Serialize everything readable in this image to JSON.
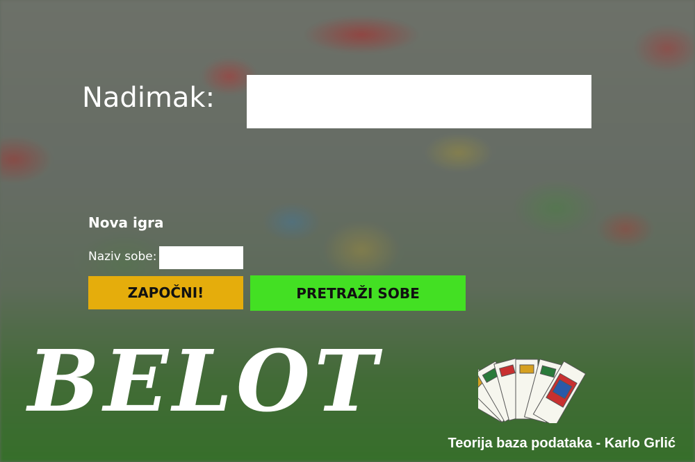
{
  "form": {
    "nickname_label": "Nadimak:",
    "nickname_value": "",
    "new_game_title": "Nova igra",
    "room_name_label": "Naziv sobe:",
    "room_name_value": "",
    "start_button": "ZAPOČNI!",
    "search_rooms_button": "PRETRAŽI SOBE"
  },
  "branding": {
    "logo_text": "BELOT",
    "credit": "Teorija baza podataka - Karlo Grlić",
    "cards_icon": "playing-cards-fan-icon"
  },
  "colors": {
    "start_button": "#e5ad0c",
    "search_button": "#43e023"
  }
}
